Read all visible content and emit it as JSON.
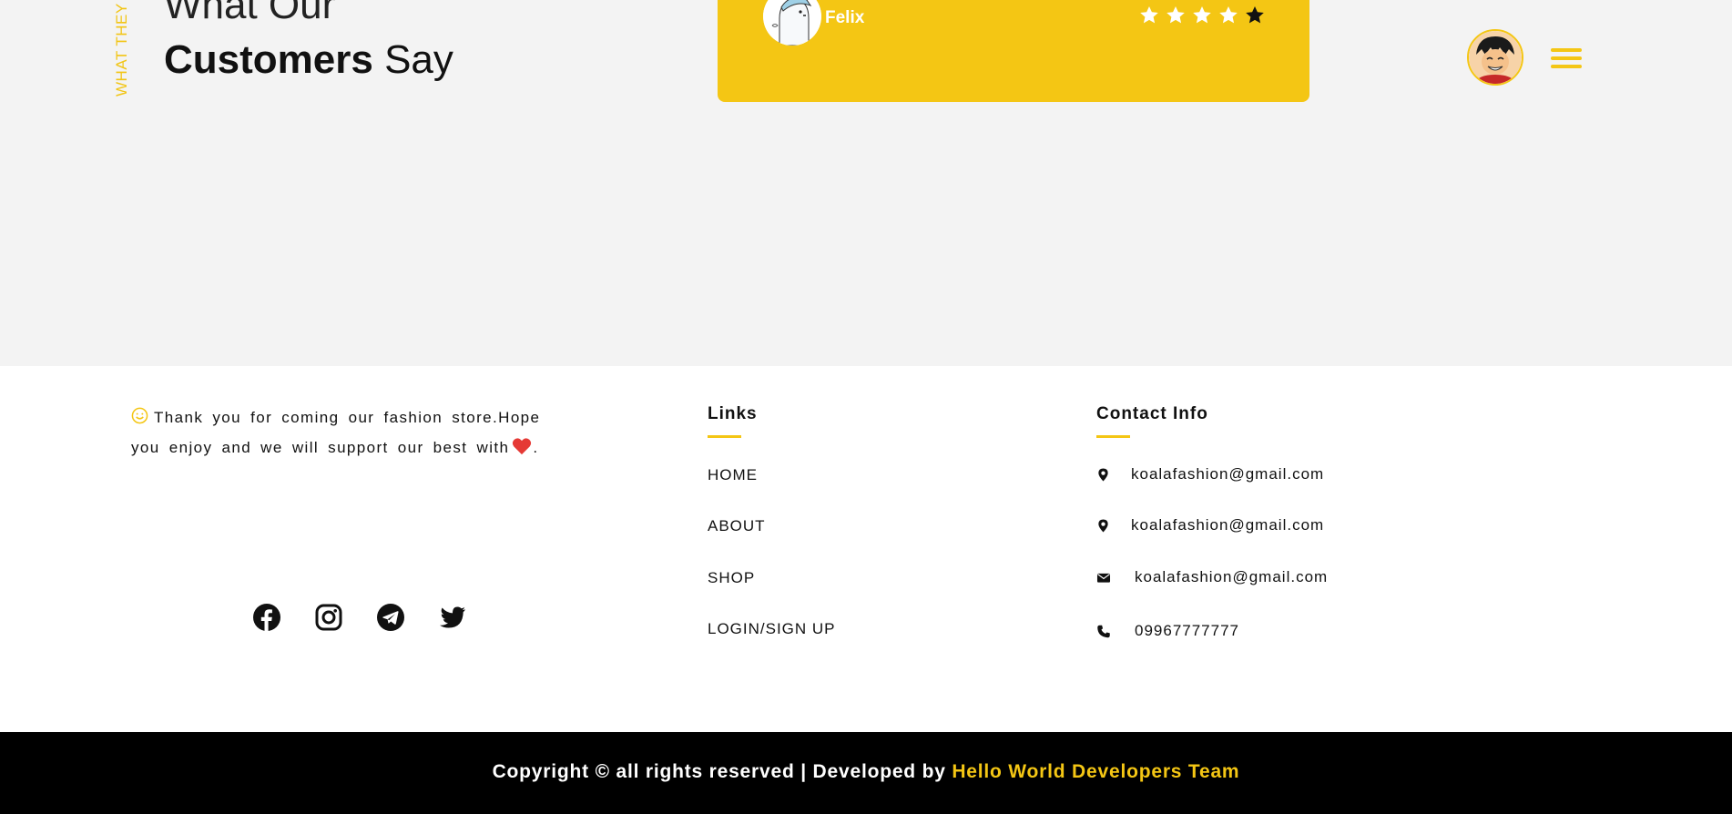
{
  "testimonials": {
    "vertical_label": "WHAT THEY SAY",
    "heading_line1": "What Our",
    "heading_bold": "Customers",
    "heading_light": "Say",
    "review": {
      "name": "Felix",
      "rating": 4,
      "max_rating": 5
    }
  },
  "header": {
    "avatar_icon": "user-avatar-icon",
    "menu_icon": "hamburger-menu-icon"
  },
  "footer": {
    "thanks_text": "Thank you for coming our fashion store.Hope you enjoy and we will support our best with",
    "thanks_end": ".",
    "socials": [
      "facebook-icon",
      "instagram-icon",
      "telegram-icon",
      "twitter-icon"
    ],
    "links_title": "Links",
    "links": [
      "HOME",
      "ABOUT",
      "SHOP",
      "LOGIN/SIGN UP"
    ],
    "contact_title": "Contact Info",
    "contacts": [
      {
        "icon": "location-pin-icon",
        "text": "koalafashion@gmail.com"
      },
      {
        "icon": "location-pin-icon",
        "text": "koalafashion@gmail.com"
      },
      {
        "icon": "envelope-icon",
        "text": "koalafashion@gmail.com"
      },
      {
        "icon": "phone-icon",
        "text": "09967777777"
      }
    ]
  },
  "copyright": {
    "text": "Copyright © all rights reserved | Developed by",
    "team": "Hello World Developers Team"
  },
  "colors": {
    "accent": "#f4c614",
    "background": "#f3f3f3",
    "footer_bg": "#ffffff",
    "copyright_bg": "#000000",
    "heart": "#e53935"
  }
}
